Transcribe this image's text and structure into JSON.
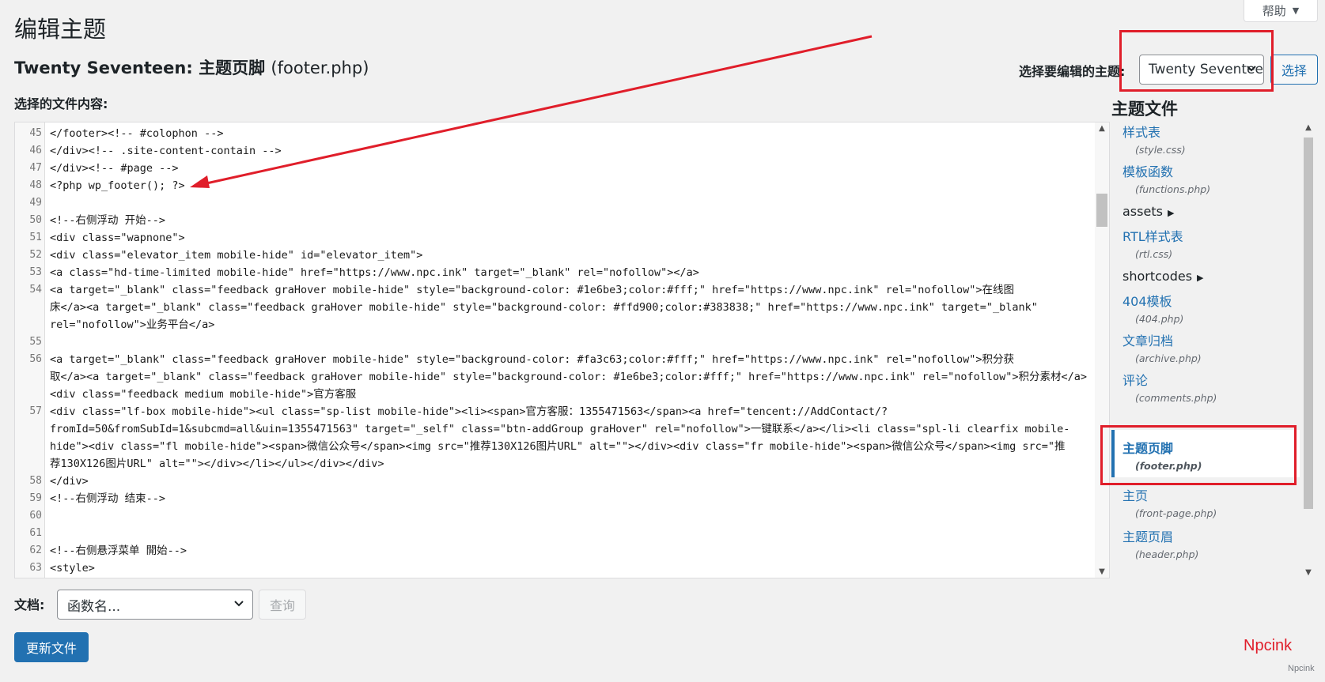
{
  "help": {
    "label": "帮助"
  },
  "header": {
    "title": "编辑主题",
    "subtitle_theme": "Twenty Seventeen:",
    "subtitle_part": "主题页脚",
    "subtitle_file": "(footer.php)"
  },
  "theme_picker": {
    "label": "选择要编辑的主题:",
    "selected": "Twenty Seventeen",
    "button": "选择"
  },
  "editor": {
    "label": "选择的文件内容:",
    "lines": [
      {
        "n": "45",
        "code": "        </footer><!-- #colophon -->"
      },
      {
        "n": "46",
        "code": "    </div><!-- .site-content-contain -->"
      },
      {
        "n": "47",
        "code": "</div><!-- #page -->"
      },
      {
        "n": "48",
        "code": "<?php wp_footer(); ?>"
      },
      {
        "n": "49",
        "code": ""
      },
      {
        "n": "50",
        "code": "<!--右侧浮动 开始-->"
      },
      {
        "n": "51",
        "code": "<div class=\"wapnone\">"
      },
      {
        "n": "52",
        "code": "      <div class=\"elevator_item mobile-hide\" id=\"elevator_item\">"
      },
      {
        "n": "53",
        "code": "            <a class=\"hd-time-limited mobile-hide\" href=\"https://www.npc.ink\" target=\"_blank\" rel=\"nofollow\"></a>"
      },
      {
        "n": "54",
        "code": "            <a target=\"_blank\" class=\"feedback graHover mobile-hide\" style=\"background-color: #1e6be3;color:#fff;\" href=\"https://www.npc.ink\" rel=\"nofollow\">在线图"
      },
      {
        "n": "",
        "code": "床</a><a target=\"_blank\" class=\"feedback graHover mobile-hide\" style=\"background-color: #ffd900;color:#383838;\" href=\"https://www.npc.ink\" target=\"_blank\""
      },
      {
        "n": "",
        "code": "rel=\"nofollow\">业务平台</a>"
      },
      {
        "n": "55",
        "code": ""
      },
      {
        "n": "56",
        "code": "            <a target=\"_blank\" class=\"feedback graHover mobile-hide\" style=\"background-color: #fa3c63;color:#fff;\" href=\"https://www.npc.ink\" rel=\"nofollow\">积分获"
      },
      {
        "n": "",
        "code": "取</a><a target=\"_blank\" class=\"feedback graHover mobile-hide\" style=\"background-color: #1e6be3;color:#fff;\" href=\"https://www.npc.ink\" rel=\"nofollow\">积分素材</a>"
      },
      {
        "n": "",
        "code": "<div class=\"feedback medium mobile-hide\">官方客服"
      },
      {
        "n": "57",
        "code": "                  <div class=\"lf-box mobile-hide\"><ul class=\"sp-list mobile-hide\"><li><span>官方客服：1355471563</span><a href=\"tencent://AddContact/?"
      },
      {
        "n": "",
        "code": "fromId=50&fromSubId=1&subcmd=all&uin=1355471563\" target=\"_self\" class=\"btn-addGroup graHover\" rel=\"nofollow\">一键联系</a></li><li class=\"spl-li clearfix mobile-"
      },
      {
        "n": "",
        "code": "hide\"><div class=\"fl mobile-hide\"><span>微信公众号</span><img src=\"推荐130X126图片URL\" alt=\"\"></div><div class=\"fr mobile-hide\"><span>微信公众号</span><img src=\"推"
      },
      {
        "n": "",
        "code": "荐130X126图片URL\" alt=\"\"></div></li></ul></div></div>"
      },
      {
        "n": "58",
        "code": "          </div>"
      },
      {
        "n": "59",
        "code": "      <!--右侧浮动 结束-->"
      },
      {
        "n": "60",
        "code": ""
      },
      {
        "n": "61",
        "code": ""
      },
      {
        "n": "62",
        "code": "<!--右侧悬浮菜单 開始-->"
      },
      {
        "n": "63",
        "code": "<style>"
      }
    ]
  },
  "files": {
    "heading": "主题文件",
    "items": [
      {
        "label": "样式表",
        "file": "(style.css)"
      },
      {
        "label": "模板函数",
        "file": "(functions.php)"
      },
      {
        "label": "assets",
        "file": ""
      },
      {
        "label": "RTL样式表",
        "file": "(rtl.css)"
      },
      {
        "label": "shortcodes",
        "file": ""
      },
      {
        "label": "404模板",
        "file": "(404.php)"
      },
      {
        "label": "文章归档",
        "file": "(archive.php)"
      },
      {
        "label": "评论",
        "file": "(comments.php)"
      },
      {
        "label": "主题页脚",
        "file": "(footer.php)"
      },
      {
        "label": "主页",
        "file": "(front-page.php)"
      },
      {
        "label": "主题页眉",
        "file": "(header.php)"
      }
    ]
  },
  "docs": {
    "label": "文档:",
    "placeholder": "函数名...",
    "query_button": "查询"
  },
  "update_button": "更新文件",
  "watermark": {
    "brand": "Npcink",
    "small": "Npcink"
  }
}
